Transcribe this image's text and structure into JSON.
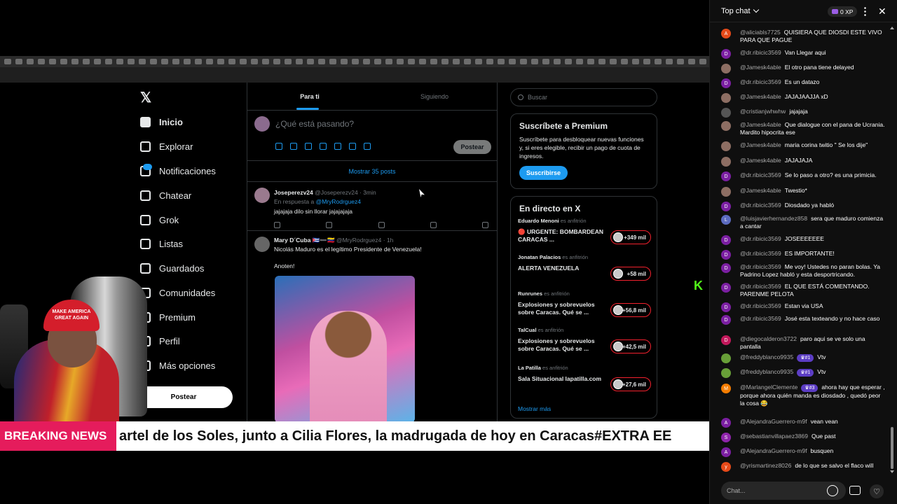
{
  "x_nav": {
    "items": [
      {
        "label": "Inicio",
        "icon": "home-icon"
      },
      {
        "label": "Explorar",
        "icon": "search-icon"
      },
      {
        "label": "Notificaciones",
        "icon": "bell-icon"
      },
      {
        "label": "Chatear",
        "icon": "mail-icon"
      },
      {
        "label": "Grok",
        "icon": "grok-icon"
      },
      {
        "label": "Listas",
        "icon": "list-icon"
      },
      {
        "label": "Guardados",
        "icon": "bookmark-icon"
      },
      {
        "label": "Comunidades",
        "icon": "people-icon"
      },
      {
        "label": "Premium",
        "icon": "x-icon"
      },
      {
        "label": "Perfil",
        "icon": "user-icon"
      },
      {
        "label": "Más opciones",
        "icon": "more-icon"
      }
    ],
    "post_button": "Postear"
  },
  "feed": {
    "tabs": [
      "Para ti",
      "Siguiendo"
    ],
    "compose_placeholder": "¿Qué está pasando?",
    "compose_post": "Postear",
    "show_more": "Mostrar 35 posts",
    "tweets": [
      {
        "name": "Joseperezv24",
        "handle": "@Joseperezv24",
        "time": "· 3min",
        "reply_prefix": "En respuesta a",
        "reply_to": "@MryRodrguez4",
        "text": "jajajaja dilo sin llorar jajajajaja"
      },
      {
        "name": "Mary D´Cuba",
        "flags": "🇨🇺➖🇻🇪",
        "handle": "@MryRodrguez4",
        "time": "· 1h",
        "text": "Nicolás Maduro es el legítimo Presidente de Venezuela!",
        "text2": "Anoten!"
      }
    ]
  },
  "right": {
    "search_placeholder": "Buscar",
    "premium": {
      "title": "Suscríbete a Premium",
      "body": "Suscríbete para desbloquear nuevas funciones y, si eres elegible, recibir un pago de cuota de ingresos.",
      "button": "Suscribirse"
    },
    "live": {
      "title": "En directo en X",
      "items": [
        {
          "host": "Eduardo Menoni",
          "role": "es anfitrión",
          "title": "🔴 URGENTE: BOMBARDEAN CARACAS ...",
          "count": "+349 mil"
        },
        {
          "host": "Jonatan Palacios",
          "role": "es anfitrión",
          "title": "ALERTA VENEZUELA",
          "count": "+58 mil"
        },
        {
          "host": "Runrunes",
          "role": "es anfitrión",
          "title": "Explosiones y sobrevuelos sobre Caracas. Qué se ...",
          "count": "+56,8 mil"
        },
        {
          "host": "TalCual",
          "role": "es anfitrión",
          "title": "Explosiones y sobrevuelos sobre Caracas. Qué se ...",
          "count": "+42,5 mil"
        },
        {
          "host": "La Patilla",
          "role": "es anfitrión",
          "title": "Sala Situacional lapatilla.com",
          "count": "+27,6 mil"
        }
      ],
      "more": "Mostrar más"
    }
  },
  "overlay": {
    "cap_text": "MAKE AMERICA GREAT AGAIN",
    "breaking": "BREAKING NEWS",
    "ticker": "artel de los Soles, junto a Cilia Flores, la madrugada de hoy en Caracas#EXTRA EE",
    "kick_logo": "K",
    "kick_count": "1"
  },
  "chat": {
    "header": "Top chat",
    "xp": "0 XP",
    "input_placeholder": "Chat...",
    "messages": [
      {
        "av": "A",
        "color": "#e64a19",
        "user": "@aliciabls7725",
        "text": "QUISIERA QUE DIOSDI ESTE VIVO PARA QUE PAGUE"
      },
      {
        "av": "D",
        "color": "#7b1fa2",
        "user": "@dr.ribicic3569",
        "text": "Van Llegar aqui"
      },
      {
        "av": "",
        "color": "#8d6e63",
        "user": "@Jamesk4able",
        "text": "El otro pana tiene delayed"
      },
      {
        "av": "D",
        "color": "#7b1fa2",
        "user": "@dr.ribicic3569",
        "text": "Es un datazo"
      },
      {
        "av": "",
        "color": "#8d6e63",
        "user": "@Jamesk4able",
        "text": "JAJAJAAJJA xD"
      },
      {
        "av": "",
        "color": "#555",
        "user": "@cristianjwhwhw",
        "text": "jajajaja"
      },
      {
        "av": "",
        "color": "#8d6e63",
        "user": "@Jamesk4able",
        "text": "Que dialogue con el pana de Ucrania. Mardito hipocrita ese"
      },
      {
        "av": "",
        "color": "#8d6e63",
        "user": "@Jamesk4able",
        "text": "maria corina twitio \" Se los dije\""
      },
      {
        "av": "",
        "color": "#8d6e63",
        "user": "@Jamesk4able",
        "text": "JAJAJAJA"
      },
      {
        "av": "D",
        "color": "#7b1fa2",
        "user": "@dr.ribicic3569",
        "text": "Se lo paso a otro? es una primicia."
      },
      {
        "av": "",
        "color": "#8d6e63",
        "user": "@Jamesk4able",
        "text": "Twestio*"
      },
      {
        "av": "D",
        "color": "#7b1fa2",
        "user": "@dr.ribicic3569",
        "text": "Diosdado ya habló"
      },
      {
        "av": "L",
        "color": "#5c6bc0",
        "user": "@luisjavierhernandez858",
        "text": "sera que maduro comienza a cantar"
      },
      {
        "av": "D",
        "color": "#7b1fa2",
        "user": "@dr.ribicic3569",
        "text": "JOSEEEEEEE"
      },
      {
        "av": "D",
        "color": "#7b1fa2",
        "user": "@dr.ribicic3569",
        "text": "ES IMPORTANTE!"
      },
      {
        "av": "D",
        "color": "#7b1fa2",
        "user": "@dr.ribicic3569",
        "text": "Me voy! Ustedes no paran bolas. Ya Padrino Lopez habló y esta desportricando."
      },
      {
        "av": "D",
        "color": "#7b1fa2",
        "user": "@dr.ribicic3569",
        "text": "EL QUE ESTÁ COMENTANDO. PARENME PELOTA"
      },
      {
        "av": "D",
        "color": "#7b1fa2",
        "user": "@dr.ribicic3569",
        "text": "Estan via USA"
      },
      {
        "av": "D",
        "color": "#7b1fa2",
        "user": "@dr.ribicic3569",
        "text": "José esta texteando y no hace caso"
      },
      {
        "av": "D",
        "color": "#c2185b",
        "user": "@diegocalderon3722",
        "text": "paro aqui se ve solo una pantalla"
      },
      {
        "av": "",
        "color": "#689f38",
        "user": "@freddyblanco9935",
        "tag": "♛#1",
        "text": "Vtv"
      },
      {
        "av": "",
        "color": "#689f38",
        "user": "@freddyblanco9935",
        "tag": "♛#1",
        "text": "Vtv"
      },
      {
        "av": "M",
        "color": "#f57c00",
        "user": "@MarlangelClemente",
        "tag": "♛#3",
        "text": "ahora hay que esperar , porque ahora quién manda es diosdado , quedó peor la cosa 😂"
      },
      {
        "av": "A",
        "color": "#7b1fa2",
        "user": "@AlejandraGuerrero-m9f",
        "text": "vean vean"
      },
      {
        "av": "S",
        "color": "#8e24aa",
        "user": "@sebastianvillapaez3869",
        "text": "Que past"
      },
      {
        "av": "A",
        "color": "#7b1fa2",
        "user": "@AlejandraGuerrero-m9f",
        "text": "busquen"
      },
      {
        "av": "y",
        "color": "#e64a19",
        "user": "@yrismartinez8026",
        "text": "de lo que se salvo el flaco will"
      }
    ]
  },
  "colors": {
    "accent": "#1d9bf0",
    "live_red": "#f4212e",
    "breaking": "#e51c5c",
    "kick_green": "#53fc18"
  }
}
